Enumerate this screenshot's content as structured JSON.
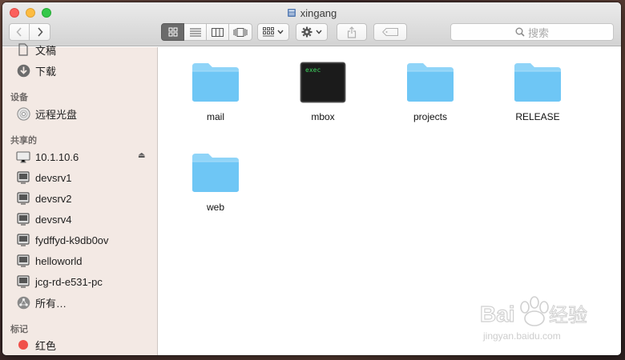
{
  "window": {
    "title": "xingang"
  },
  "toolbar": {
    "back_icon": "chevron-left-icon",
    "forward_icon": "chevron-right-icon",
    "view_modes": [
      "icon-view-icon",
      "list-view-icon",
      "column-view-icon",
      "coverflow-view-icon"
    ],
    "active_view": "icon",
    "arrange_icon": "arrange-grid-icon",
    "action_icon": "gear-icon",
    "share_icon": "share-icon",
    "tag_icon": "tag-icon",
    "search_placeholder": "搜索"
  },
  "sidebar": {
    "top_partial_item": "文稿",
    "items_top": [
      {
        "label": "下载",
        "icon": "download-icon"
      }
    ],
    "sections": [
      {
        "heading": "设备",
        "items": [
          {
            "label": "远程光盘",
            "icon": "disc-icon"
          }
        ]
      },
      {
        "heading": "共享的",
        "items": [
          {
            "label": "10.1.10.6",
            "icon": "display-icon",
            "eject": true
          },
          {
            "label": "devsrv1",
            "icon": "monitor-icon"
          },
          {
            "label": "devsrv2",
            "icon": "monitor-icon"
          },
          {
            "label": "devsrv4",
            "icon": "monitor-icon"
          },
          {
            "label": "fydffyd-k9db0ov",
            "icon": "monitor-icon"
          },
          {
            "label": "helloworld",
            "icon": "monitor-icon"
          },
          {
            "label": "jcg-rd-e531-pc",
            "icon": "monitor-icon"
          },
          {
            "label": "所有…",
            "icon": "network-icon"
          }
        ]
      },
      {
        "heading": "标记",
        "items": [
          {
            "label": "红色",
            "icon": "red-tag-icon",
            "color": "#f0504a"
          }
        ]
      }
    ]
  },
  "files": [
    {
      "name": "mail",
      "type": "folder"
    },
    {
      "name": "mbox",
      "type": "exec",
      "badge": "exec"
    },
    {
      "name": "projects",
      "type": "folder"
    },
    {
      "name": "RELEASE",
      "type": "folder"
    },
    {
      "name": "web",
      "type": "folder"
    }
  ],
  "colors": {
    "folder": "#6ec6f5",
    "folder_tab": "#8fd4f8",
    "sidebar_bg": "#f3e9e4",
    "active_segment": "#6b6b6b"
  },
  "watermark": {
    "brand": "Bai",
    "brand_cn": "经验",
    "url": "jingyan.baidu.com"
  }
}
